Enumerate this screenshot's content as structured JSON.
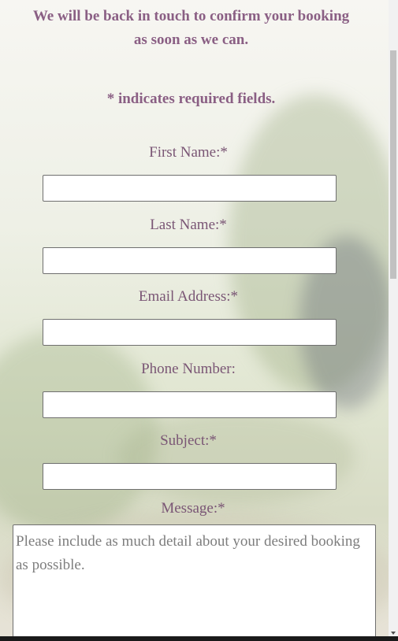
{
  "notice": {
    "line1": "We will be back in touch to confirm your booking",
    "line2": "as soon as we can.",
    "required_note": "* indicates required fields."
  },
  "form": {
    "first_name_label": "First Name:*",
    "last_name_label": "Last Name:*",
    "email_label": "Email Address:*",
    "phone_label": "Phone Number:",
    "subject_label": "Subject:*",
    "message_label": "Message:*",
    "message_placeholder": "Please include as much detail about your desired booking as possible."
  }
}
